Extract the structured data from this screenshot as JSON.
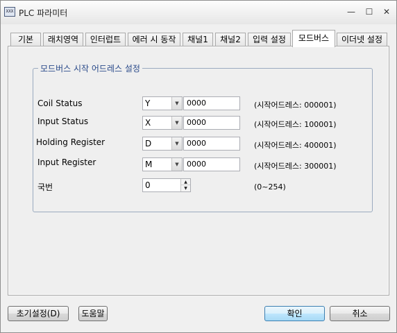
{
  "window": {
    "title": "PLC 파라미터",
    "icon_text": "XXX",
    "buttons": {
      "minimize": "—",
      "maximize": "☐",
      "close": "✕"
    }
  },
  "tabs": [
    {
      "label": "기본"
    },
    {
      "label": "래치영역"
    },
    {
      "label": "인터럽트"
    },
    {
      "label": "에러 시 동작"
    },
    {
      "label": "채널1"
    },
    {
      "label": "채널2"
    },
    {
      "label": "입력 설정"
    },
    {
      "label": "모드버스"
    },
    {
      "label": "이더넷 설정"
    }
  ],
  "active_tab": "모드버스",
  "group": {
    "title": "모드버스 시작 어드레스 설정",
    "rows": [
      {
        "label": "Coil Status",
        "device": "Y",
        "address": "0000",
        "hint": "(시작어드레스: 000001)"
      },
      {
        "label": "Input Status",
        "device": "X",
        "address": "0000",
        "hint": "(시작어드레스: 100001)"
      },
      {
        "label": "Holding Register",
        "device": "D",
        "address": "0000",
        "hint": "(시작어드레스: 400001)"
      },
      {
        "label": "Input Register",
        "device": "M",
        "address": "0000",
        "hint": "(시작어드레스: 300001)"
      }
    ],
    "station": {
      "label": "국번",
      "value": "0",
      "hint": "(0~254)"
    }
  },
  "footer": {
    "reset": "초기설정(D)",
    "help": "도움말",
    "ok": "확인",
    "cancel": "취소"
  }
}
